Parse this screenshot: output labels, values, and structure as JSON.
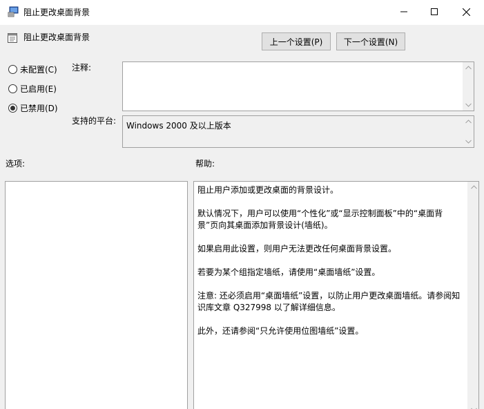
{
  "window": {
    "title": "阻止更改桌面背景",
    "icons": {
      "app": "policy-window-icon",
      "minimize": "minimize-icon",
      "maximize": "maximize-icon",
      "close": "close-icon"
    }
  },
  "header": {
    "title": "阻止更改桌面背景",
    "icon": "policy-setting-icon",
    "prev_button": "上一个设置(P)",
    "next_button": "下一个设置(N)"
  },
  "state": {
    "options": [
      {
        "label": "未配置(C)",
        "selected": false
      },
      {
        "label": "已启用(E)",
        "selected": false
      },
      {
        "label": "已禁用(D)",
        "selected": true
      }
    ]
  },
  "comment": {
    "label": "注释:",
    "value": ""
  },
  "platform": {
    "label": "支持的平台:",
    "value": "Windows 2000 及以上版本"
  },
  "options_section": {
    "label": "选项:"
  },
  "help_section": {
    "label": "帮助:",
    "paragraphs": [
      "阻止用户添加或更改桌面的背景设计。",
      "默认情况下，用户可以使用“个性化”或“显示控制面板”中的“桌面背景”页向其桌面添加背景设计(墙纸)。",
      "如果启用此设置，则用户无法更改任何桌面背景设置。",
      "若要为某个组指定墙纸，请使用“桌面墙纸”设置。",
      "注意: 还必须启用“桌面墙纸”设置，以防止用户更改桌面墙纸。请参阅知识库文章 Q327998 以了解详细信息。",
      "此外，还请参阅“只允许使用位图墙纸”设置。"
    ]
  },
  "colors": {
    "title_bg": "#ffffff",
    "dialog_bg": "#f0f0f0",
    "button_bg": "#e1e1e1",
    "border": "#a0a0a0"
  }
}
